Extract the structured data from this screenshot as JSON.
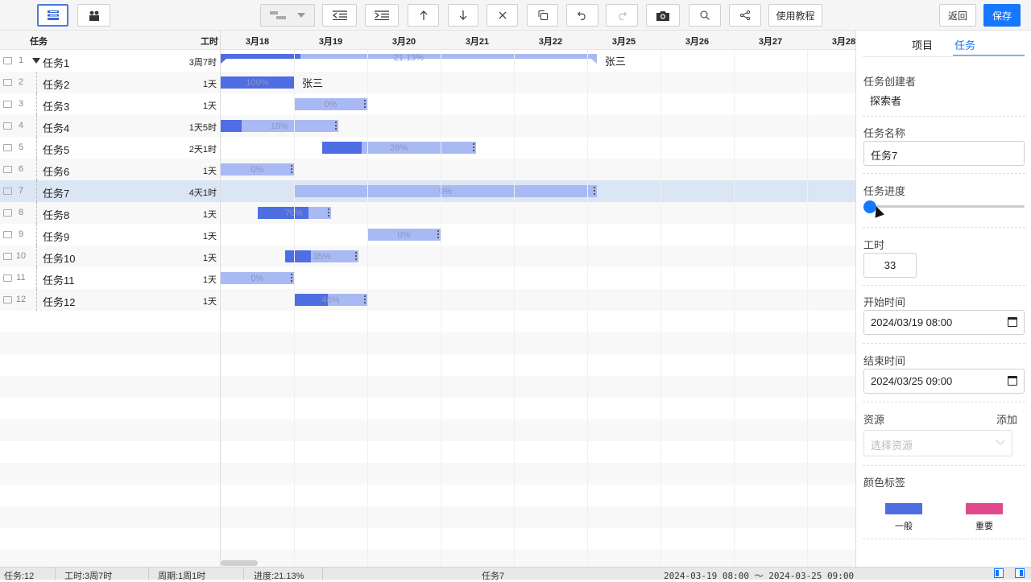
{
  "toolbar": {
    "tutorial_label": "使用教程",
    "back_label": "返回",
    "save_label": "保存"
  },
  "grid": {
    "col_task": "任务",
    "col_duration": "工时"
  },
  "timeline": {
    "days": [
      "3月18",
      "3月19",
      "3月20",
      "3月21",
      "3月22",
      "3月25",
      "3月26",
      "3月27",
      "3月28"
    ]
  },
  "tasks": [
    {
      "num": "1",
      "name": "任务1",
      "duration": "3周7时",
      "progress_label": "21.13%",
      "progress": 0.2113,
      "resource": "张三"
    },
    {
      "num": "2",
      "name": "任务2",
      "duration": "1天",
      "progress_label": "100%",
      "progress": 1.0,
      "resource": "张三"
    },
    {
      "num": "3",
      "name": "任务3",
      "duration": "1天",
      "progress_label": "0%",
      "progress": 0
    },
    {
      "num": "4",
      "name": "任务4",
      "duration": "1天5时",
      "progress_label": "18%",
      "progress": 0.18
    },
    {
      "num": "5",
      "name": "任务5",
      "duration": "2天1时",
      "progress_label": "26%",
      "progress": 0.26
    },
    {
      "num": "6",
      "name": "任务6",
      "duration": "1天",
      "progress_label": "0%",
      "progress": 0
    },
    {
      "num": "7",
      "name": "任务7",
      "duration": "4天1时",
      "progress_label": "0%",
      "progress": 0
    },
    {
      "num": "8",
      "name": "任务8",
      "duration": "1天",
      "progress_label": "70%",
      "progress": 0.7
    },
    {
      "num": "9",
      "name": "任务9",
      "duration": "1天",
      "progress_label": "0%",
      "progress": 0
    },
    {
      "num": "10",
      "name": "任务10",
      "duration": "1天",
      "progress_label": "35%",
      "progress": 0.35
    },
    {
      "num": "11",
      "name": "任务11",
      "duration": "1天",
      "progress_label": "0%",
      "progress": 0
    },
    {
      "num": "12",
      "name": "任务12",
      "duration": "1天",
      "progress_label": "46%",
      "progress": 0.46
    }
  ],
  "panel": {
    "tab_project": "项目",
    "tab_task": "任务",
    "creator_label": "任务创建者",
    "creator_value": "探索者",
    "name_label": "任务名称",
    "name_value": "任务7",
    "progress_label": "任务进度",
    "progress_value": 0,
    "hours_label": "工时",
    "hours_value": "33",
    "start_label": "开始时间",
    "start_value": "2024/03/19 08:00",
    "end_label": "结束时间",
    "end_value": "2024/03/25 09:00",
    "resource_label": "资源",
    "resource_add": "添加",
    "resource_placeholder": "选择资源",
    "color_label": "颜色标签",
    "color_normal": "一般",
    "color_important": "重要",
    "color_normal_hex": "#4f6ee3",
    "color_important_hex": "#e24a8d"
  },
  "status": {
    "tasks": "任务:12",
    "hours": "工时:3周7时",
    "period": "周期:1周1时",
    "progress": "进度:21.13%",
    "current": "任务7",
    "range": "2024-03-19 08:00 ～ 2024-03-25 09:00"
  }
}
